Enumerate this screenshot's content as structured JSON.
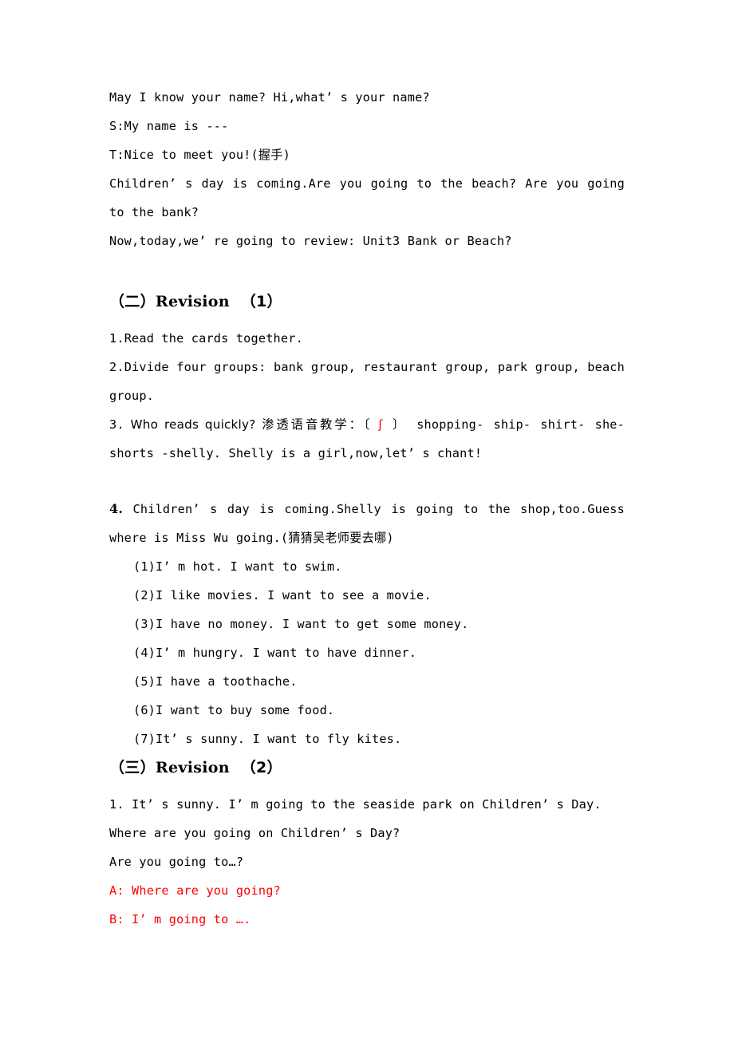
{
  "document": {
    "type": "lesson-plan",
    "text_color": "#000000",
    "highlight_color": "#ff0000",
    "background_color": "#ffffff"
  },
  "intro": {
    "lines": [
      "May I know your name? Hi,what’ s your name?",
      "S:My name is ---",
      "T:Nice to meet you!(握手)",
      "Children’ s day is coming.Are you going to the beach? Are you going to the bank?",
      "Now,today,we’ re going to review: Unit3 Bank or Beach?"
    ]
  },
  "section_one": {
    "ordinal": "（二）",
    "title": "Revision",
    "number": "（1）",
    "items": [
      {
        "number": "1.",
        "text": "Read the cards together.",
        "bold_number": false
      },
      {
        "number": "2.",
        "text": "Divide four groups: bank group, restaurant group, park group, beach group.",
        "bold_number": false
      },
      {
        "number": "3.",
        "text_before_ipa": " Who reads quickly? 渗透语音教学：〔 ",
        "ipa_symbol": "ʃ",
        "text_after_ipa": " 〕 shopping- ship- shirt- she-shorts  -shelly. Shelly is a girl,now,let’ s chant!",
        "bold_number": false
      }
    ],
    "item_four": {
      "number": "4.",
      "bold_number": true,
      "text": " Children’ s day is coming.Shelly is going to the shop,too.Guess where is Miss Wu going.(猜猜吴老师要去哪)",
      "sub_items": [
        "(1)I’ m hot.  I want to swim.",
        "(2)I like movies. I want to see a movie.",
        "(3)I have no money. I want to get some money.",
        "(4)I’ m hungry. I want to have dinner.",
        "(5)I have a toothache.",
        "(6)I want to buy some food.",
        "(7)It’ s sunny. I want to fly kites."
      ]
    }
  },
  "section_two": {
    "ordinal": "（三）",
    "title": "Revision",
    "number": "（2）",
    "lines": [
      {
        "text": "1. It’ s sunny. I’ m going to the seaside park on Children’ s Day.",
        "color": "black"
      },
      {
        "text": "Where are you going on Children’ s Day?",
        "color": "black"
      },
      {
        "text": "Are you going to…?",
        "color": "black"
      },
      {
        "text": "A: Where are you going?",
        "color": "red"
      },
      {
        "text": "B: I’ m going to ….",
        "color": "red"
      }
    ]
  }
}
